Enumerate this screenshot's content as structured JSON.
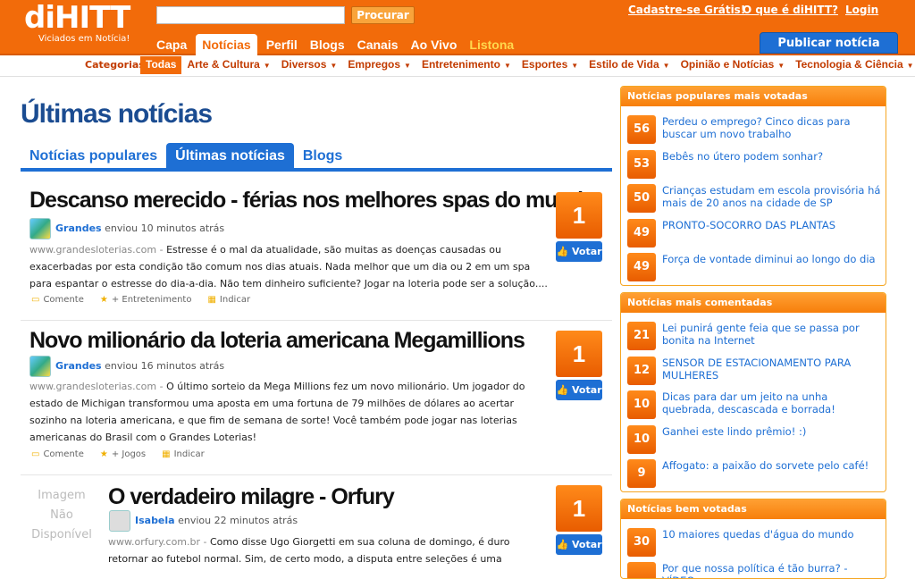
{
  "header": {
    "logo": "diHITT",
    "tagline": "Viciados em Notícia!",
    "search_placeholder": "",
    "search_button": "Procurar",
    "links": {
      "signup": "Cadastre-se Grátis!",
      "about": "O que é diHITT?",
      "login": "Login"
    },
    "nav": [
      "Capa",
      "Notícias",
      "Perfil",
      "Blogs",
      "Canais",
      "Ao Vivo",
      "Listona"
    ],
    "publish_button": "Publicar notícia"
  },
  "categories": {
    "label": "Categorias:",
    "items": [
      "Todas",
      "Arte & Cultura",
      "Diversos",
      "Empregos",
      "Entretenimento",
      "Esportes",
      "Estilo de Vida",
      "Opinião e Notícias",
      "Tecnologia & Ciência"
    ]
  },
  "main": {
    "title": "Últimas notícias",
    "tabs": [
      "Notícias populares",
      "Últimas notícias",
      "Blogs"
    ],
    "stories": [
      {
        "title": "Descanso merecido - férias nos melhores spas do mundo",
        "user": "Grandes",
        "time": "enviou 10 minutos atrás",
        "source": "www.grandesloterias.com -",
        "text": "Estresse é o mal da atualidade, são muitas as doenças causadas ou exacerbadas por esta condição tão comum nos dias atuais. Nada melhor que um dia ou 2 em um spa para espantar o estresse do dia-a-dia. Não tem dinheiro suficiente? Jogar na loteria pode ser a solução....",
        "comment": "Comente",
        "category": "+ Entretenimento",
        "indicate": "Indicar",
        "votes": "1",
        "vote_label": "Votar"
      },
      {
        "title": "Novo milionário da loteria americana Megamillions",
        "user": "Grandes",
        "time": "enviou 16 minutos atrás",
        "source": "www.grandesloterias.com -",
        "text": "O último sorteio da Mega Millions fez um novo milionário. Um jogador do estado de Michigan transformou uma aposta em uma fortuna de 79 milhões de dólares ao acertar sozinho na loteria americana, e que fim de semana de sorte! Você também pode jogar nas loterias americanas do Brasil com o Grandes Loterias!",
        "comment": "Comente",
        "category": "+ Jogos",
        "indicate": "Indicar",
        "votes": "1",
        "vote_label": "Votar"
      },
      {
        "title": "O verdadeiro milagre - Orfury",
        "user": "Isabela",
        "time": "enviou 22 minutos atrás",
        "source": "www.orfury.com.br -",
        "text": "Como disse Ugo Giorgetti em sua coluna de domingo, é duro retornar ao futebol normal. Sim, de certo modo, a disputa entre seleções é uma anormalidade do",
        "noimage": [
          "Imagem",
          "Não",
          "Disponível"
        ],
        "votes": "1",
        "vote_label": "Votar"
      }
    ]
  },
  "sidebar": {
    "popular": {
      "title": "Notícias populares mais votadas",
      "items": [
        {
          "score": "56",
          "text": "Perdeu o emprego? Cinco dicas para buscar um novo trabalho"
        },
        {
          "score": "53",
          "text": "Bebês no útero podem sonhar?"
        },
        {
          "score": "50",
          "text": "Crianças estudam em escola provisória há mais de 20 anos na cidade de SP"
        },
        {
          "score": "49",
          "text": "PRONTO-SOCORRO DAS PLANTAS"
        },
        {
          "score": "49",
          "text": "Força de vontade diminui ao longo do dia"
        }
      ]
    },
    "commented": {
      "title": "Notícias mais comentadas",
      "items": [
        {
          "score": "21",
          "text": "Lei punirá gente feia que se passa por bonita na Internet"
        },
        {
          "score": "12",
          "text": "SENSOR DE ESTACIONAMENTO PARA MULHERES"
        },
        {
          "score": "10",
          "text": "Dicas para dar um jeito na unha quebrada, descascada e borrada!"
        },
        {
          "score": "10",
          "text": "Ganhei este lindo prêmio! :)"
        },
        {
          "score": "9",
          "text": "Affogato: a paixão do sorvete pelo café!"
        }
      ]
    },
    "wellvoted": {
      "title": "Notícias bem votadas",
      "items": [
        {
          "score": "30",
          "text": "10 maiores quedas d'água do mundo"
        },
        {
          "score": "",
          "text": "Por que nossa política é tão burra? - VÍDEO"
        }
      ]
    }
  }
}
